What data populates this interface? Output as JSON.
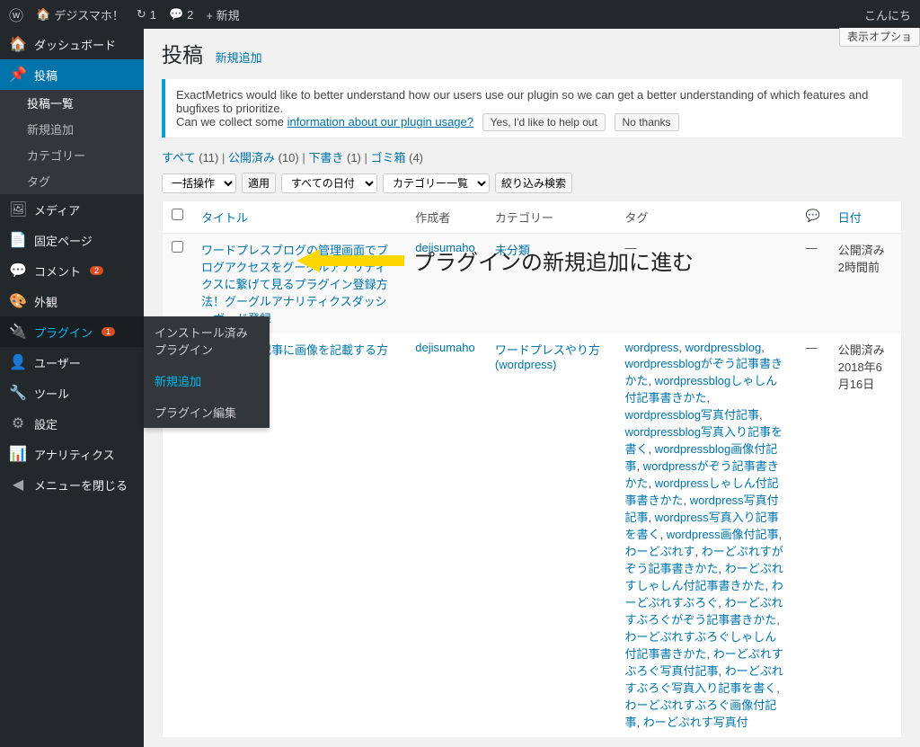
{
  "adminbar": {
    "site_name": "デジスマホ！",
    "updates": "1",
    "comments": "2",
    "new": "+ 新規",
    "greeting": "こんにち"
  },
  "screen_options": "表示オプショ",
  "sidebar": {
    "dashboard": "ダッシュボード",
    "posts": "投稿",
    "posts_sub": {
      "all": "投稿一覧",
      "new": "新規追加",
      "cat": "カテゴリー",
      "tag": "タグ"
    },
    "media": "メディア",
    "pages": "固定ページ",
    "comments": "コメント",
    "comments_badge": "2",
    "appearance": "外観",
    "plugins": "プラグイン",
    "plugins_badge": "1",
    "users": "ユーザー",
    "tools": "ツール",
    "settings": "設定",
    "analytics": "アナリティクス",
    "collapse": "メニューを閉じる"
  },
  "plugin_flyout": {
    "installed": "インストール済みプラグイン",
    "add_new": "新規追加",
    "edit": "プラグイン編集"
  },
  "page": {
    "title": "投稿",
    "add_new": "新規追加"
  },
  "notice": {
    "line1": "ExactMetrics would like to better understand how our users use our plugin so we can get a better understanding of which features and bugfixes to prioritize.",
    "line2_a": "Can we collect some ",
    "link": "information about our plugin usage?",
    "btn_yes": "Yes, I'd like to help out",
    "btn_no": "No thanks"
  },
  "filters": {
    "all": "すべて",
    "all_count": "(11)",
    "published": "公開済み",
    "published_count": "(10)",
    "draft": "下書き",
    "draft_count": "(1)",
    "trash": "ゴミ箱",
    "trash_count": "(4)"
  },
  "bulk": {
    "action": "一括操作",
    "apply": "適用",
    "all_dates": "すべての日付",
    "cat_list": "カテゴリー一覧",
    "filter": "絞り込み検索"
  },
  "cols": {
    "title": "タイトル",
    "author": "作成者",
    "cat": "カテゴリー",
    "tags": "タグ",
    "date": "日付"
  },
  "rows": [
    {
      "title": "ワードプレスブログの管理画面でブログアクセスをグーグルアナリティクスに繋げて見るプラグイン登録方法！グーグルアナリティクスダッシュボード登録",
      "author": "dejisumaho",
      "cat": "未分類",
      "tags": "—",
      "date_status": "公開済み",
      "date": "2時間前"
    },
    {
      "title": "ブログ内の記事に画像を記載する方法！",
      "author": "dejisumaho",
      "cat": "ワードプレスやり方(wordpress)",
      "tags": "wordpress, wordpressblog, wordpressblogがぞう記事書きかた, wordpressblogしゃしん付記事書きかた, wordpressblog写真付記事, wordpressblog写真入り記事を書く, wordpressblog画像付記事, wordpressがぞう記事書きかた, wordpressしゃしん付記事書きかた, wordpress写真付記事, wordpress写真入り記事を書く, wordpress画像付記事, わーどぷれす, わーどぷれすがぞう記事書きかた, わーどぷれすしゃしん付記事書きかた, わーどぷれすぶろぐ, わーどぷれすぶろぐがぞう記事書きかた, わーどぷれすぶろぐしゃしん付記事書きかた, わーどぷれすぶろぐ写真付記事, わーどぷれすぶろぐ写真入り記事を書く, わーどぷれすぶろぐ画像付記事, わーどぷれす写真付",
      "date_status": "公開済み",
      "date": "2018年6月16日"
    }
  ],
  "annotation": "プラグインの新規追加に進む"
}
